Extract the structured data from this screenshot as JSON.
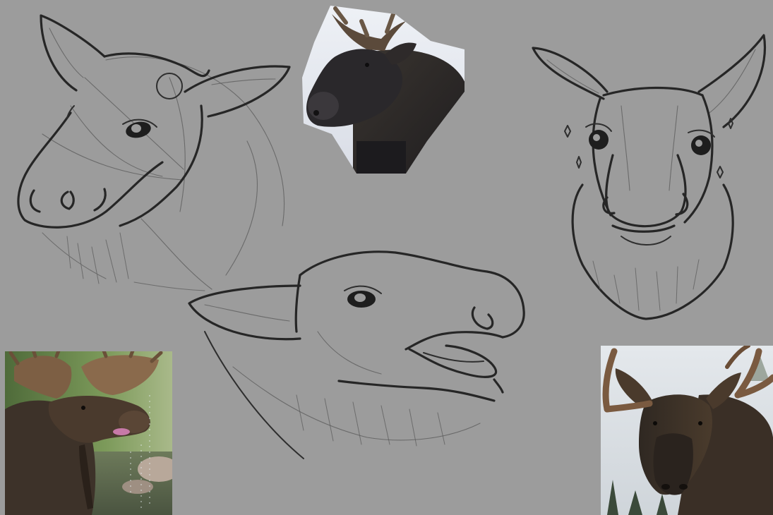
{
  "canvas": {
    "background": "#9c9c9c"
  },
  "sketches": [
    {
      "name": "moose-head-three-quarter-sketch",
      "description_color": "#262626"
    },
    {
      "name": "moose-head-front-sketch"
    },
    {
      "name": "moose-head-profile-open-mouth-sketch"
    }
  ],
  "references": [
    {
      "name": "reference-photo-bull-moose-dark",
      "palette": [
        "#2b2a2e",
        "#4a4036",
        "#e8ecf2"
      ]
    },
    {
      "name": "reference-photo-moose-drinking",
      "palette": [
        "#3d3229",
        "#6b8a4e",
        "#c79b7a"
      ]
    },
    {
      "name": "reference-photo-moose-front-antlers",
      "palette": [
        "#2a241e",
        "#6a5038",
        "#dde2e6"
      ]
    }
  ]
}
